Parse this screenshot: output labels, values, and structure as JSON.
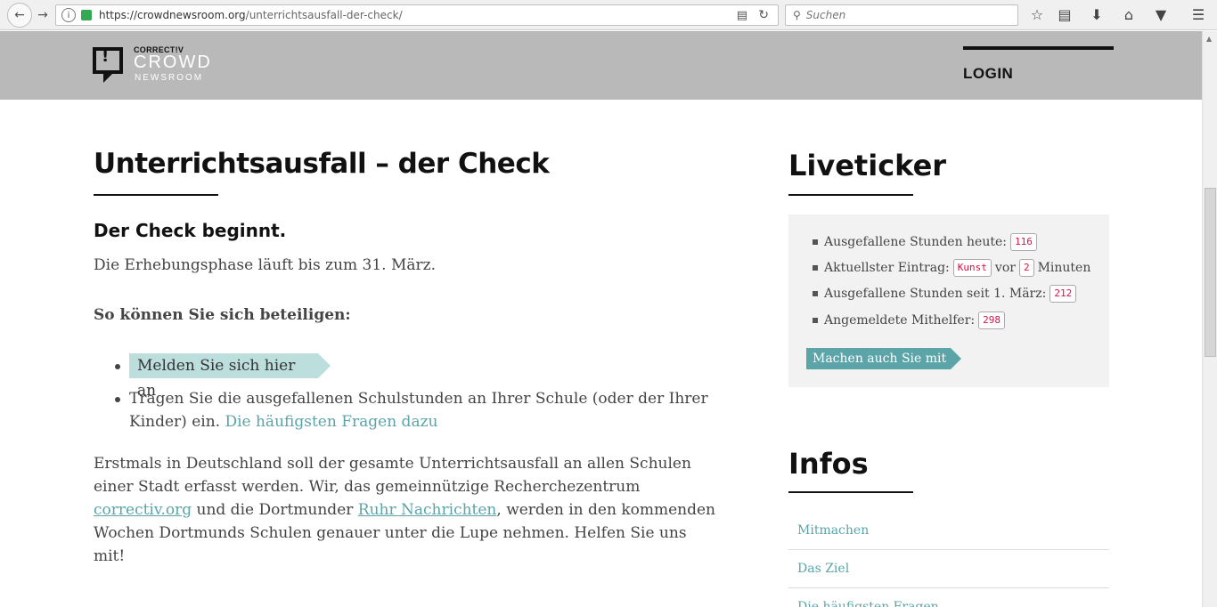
{
  "browser": {
    "url_domain": "https://crowdnewsroom.org",
    "url_path": "/unterrichtsausfall-der-check/",
    "search_placeholder": "Suchen"
  },
  "header": {
    "logo_small": "CORRECT!V",
    "logo_crowd": "CROWD",
    "logo_news": "NEWSROOM",
    "login": "LOGIN"
  },
  "main": {
    "title": "Unterrichtsausfall – der Check",
    "subtitle": "Der Check beginnt.",
    "phase_text": "Die Erhebungsphase läuft bis zum 31. März.",
    "participate_heading": "So können Sie sich beteiligen:",
    "signup_button": "Melden Sie sich hier an",
    "step2_line1": "Tragen Sie die ausgefallenen Schulstunden an Ihrer Schule (oder der Ihrer",
    "step2_line2": "Kinder) ein.",
    "faq_link": "Die häufigsten Fragen dazu",
    "para_line1": "Erstmals in Deutschland soll der gesamte Unterrichtsausfall an allen Schulen",
    "para_line2": "einer Stadt erfasst werden. Wir, das gemeinnützige Recherchezentrum",
    "correctiv_link": "correctiv.org",
    "para_line3_mid": "und die Dortmunder",
    "ruhr_link": "Ruhr Nachrichten",
    "para_line3_end": ", werden in den kommenden",
    "para_line4": "Wochen Dortmunds Schulen genauer unter die Lupe nehmen. Helfen Sie uns",
    "para_line5": "mit!"
  },
  "sidebar": {
    "liveticker_title": "Liveticker",
    "ticker": {
      "today_label": "Ausgefallene Stunden heute:",
      "today_value": "116",
      "latest_label": "Aktuellster Eintrag:",
      "latest_subject": "Kunst",
      "latest_vor": "vor",
      "latest_minutes": "2",
      "latest_unit": "Minuten",
      "since_label": "Ausgefallene Stunden seit 1. März:",
      "since_value": "212",
      "helpers_label": "Angemeldete Mithelfer:",
      "helpers_value": "298",
      "cta": "Machen auch Sie mit"
    },
    "infos_title": "Infos",
    "info_links": [
      "Mitmachen",
      "Das Ziel",
      "Die häufigsten Fragen"
    ]
  }
}
